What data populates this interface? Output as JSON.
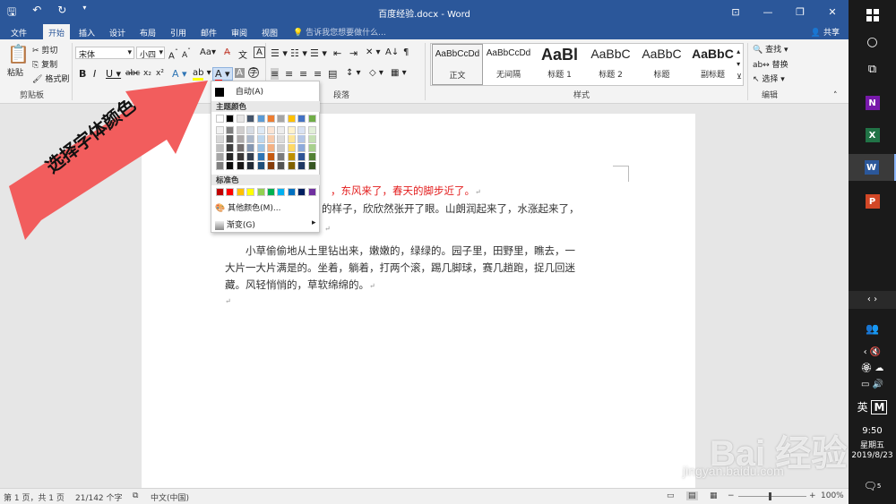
{
  "window": {
    "title": "百度经验.docx - Word",
    "qat_icons": [
      "save-icon",
      "undo-icon",
      "redo-icon"
    ],
    "accent": "#2b579a"
  },
  "tabs": [
    "文件",
    "开始",
    "插入",
    "设计",
    "布局",
    "引用",
    "邮件",
    "审阅",
    "视图"
  ],
  "active_tab": "开始",
  "tell_me": "告诉我您想要做什么...",
  "share": "共享",
  "ribbon": {
    "clipboard": {
      "paste": "粘贴",
      "cut": "剪切",
      "copy": "复制",
      "format_painter": "格式刷",
      "label": "剪贴板"
    },
    "font": {
      "font_name": "宋体",
      "font_size": "小四",
      "label": "字体",
      "aa": "Aa"
    },
    "paragraph": {
      "label": "段落"
    },
    "styles": {
      "label": "样式",
      "items": [
        {
          "sample": "AaBbCcDd",
          "name": "正文"
        },
        {
          "sample": "AaBbCcDd",
          "name": "无间隔"
        },
        {
          "sample": "AaBl",
          "name": "标题 1"
        },
        {
          "sample": "AaBbC",
          "name": "标题 2"
        },
        {
          "sample": "AaBbC",
          "name": "标题"
        },
        {
          "sample": "AaBbC",
          "name": "副标题"
        }
      ]
    },
    "editing": {
      "find": "查找",
      "replace": "替换",
      "select": "选择",
      "label": "编辑"
    }
  },
  "font_color_menu": {
    "auto": "自动(A)",
    "theme_header": "主题颜色",
    "theme_top": [
      "#ffffff",
      "#000000",
      "#e7e6e6",
      "#44546a",
      "#5b9bd5",
      "#ed7d31",
      "#a5a5a5",
      "#ffc000",
      "#4472c4",
      "#70ad47"
    ],
    "theme_shades": [
      [
        "#f2f2f2",
        "#7f7f7f",
        "#d0cece",
        "#d6dce4",
        "#deeaf6",
        "#fbe5d5",
        "#ededed",
        "#fff2cc",
        "#d9e2f3",
        "#e2efd9"
      ],
      [
        "#d8d8d8",
        "#595959",
        "#aeabab",
        "#adb9ca",
        "#bdd7ee",
        "#f7cbac",
        "#dbdbdb",
        "#fee599",
        "#b4c6e7",
        "#c5e0b3"
      ],
      [
        "#bfbfbf",
        "#3f3f3f",
        "#757070",
        "#8496b0",
        "#9cc3e5",
        "#f4b183",
        "#c9c9c9",
        "#ffd965",
        "#8eaadb",
        "#a8d08d"
      ],
      [
        "#a5a5a5",
        "#262626",
        "#3a3838",
        "#333f50",
        "#2e75b5",
        "#c55a11",
        "#7b7b7b",
        "#bf9000",
        "#2f5496",
        "#538135"
      ],
      [
        "#7f7f7f",
        "#0c0c0c",
        "#171616",
        "#222a35",
        "#1e4e79",
        "#843c0b",
        "#525252",
        "#7f6000",
        "#1f3864",
        "#375623"
      ]
    ],
    "standard_header": "标准色",
    "standard": [
      "#c00000",
      "#ff0000",
      "#ffc000",
      "#ffff00",
      "#92d050",
      "#00b050",
      "#00b0f0",
      "#0070c0",
      "#002060",
      "#7030a0"
    ],
    "more_colors": "其他颜色(M)...",
    "gradient": "渐变(G)"
  },
  "annotation": {
    "text": "选择字体颜色",
    "color": "#f05a5a"
  },
  "document": {
    "line1_red": "，东风来了，春天的脚步近了。",
    "line2": "的样子，欣欣然张开了眼。山朗润起来了，水涨起来了，",
    "para2": [
      "小草偷偷地从土里钻出来，嫩嫩的，绿绿的。园子里，田野里，瞧去，一",
      "大片一大片满是的。坐着，躺着，打两个滚，踢几脚球，赛几趟跑，捉几回迷",
      "藏。风轻悄悄的，草软绵绵的。"
    ],
    "para_mark": "↵"
  },
  "status": {
    "page": "第 1 页，共 1 页",
    "words": "21/142 个字",
    "lang": "中文(中国)",
    "zoom": "100%"
  },
  "taskbar": {
    "apps": [
      {
        "name": "onenote",
        "letter": "N",
        "color": "#7719aa"
      },
      {
        "name": "excel",
        "letter": "X",
        "color": "#217346"
      },
      {
        "name": "word",
        "letter": "W",
        "color": "#2b579a"
      },
      {
        "name": "powerpoint",
        "letter": "P",
        "color": "#d24726"
      }
    ],
    "ime": "英",
    "time": "9:50",
    "weekday": "星期五",
    "date": "2019/8/23",
    "notifications": "5"
  },
  "watermark": {
    "brand": "Bai 经验",
    "url": "jingyan.baidu.com"
  }
}
